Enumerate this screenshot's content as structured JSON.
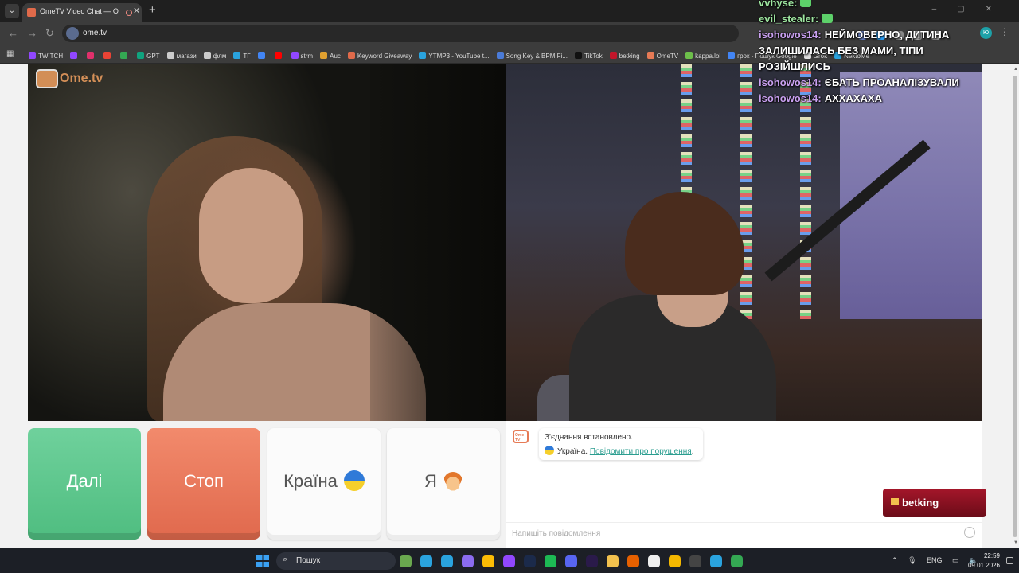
{
  "browser": {
    "tab_title": "OmeTV Video Chat — Ome",
    "url": "ome.tv",
    "bookmarks": [
      {
        "label": "TWITCH",
        "color": "#9147ff"
      },
      {
        "label": "",
        "color": "#9147ff"
      },
      {
        "label": "",
        "color": "#e1306c"
      },
      {
        "label": "",
        "color": "#ea4335"
      },
      {
        "label": "",
        "color": "#34a853"
      },
      {
        "label": "GPT",
        "color": "#10a37f"
      },
      {
        "label": "магази",
        "color": "#cccccc"
      },
      {
        "label": "флм",
        "color": "#cccccc"
      },
      {
        "label": "ТГ",
        "color": "#2aa3de"
      },
      {
        "label": "",
        "color": "#4285f4"
      },
      {
        "label": "",
        "color": "#ff0000"
      },
      {
        "label": "strm",
        "color": "#9147ff"
      },
      {
        "label": "Auc",
        "color": "#e0a030"
      },
      {
        "label": "Keyword Giveaway",
        "color": "#e06a4a"
      },
      {
        "label": "YTMP3 - YouTube t...",
        "color": "#2aa3de"
      },
      {
        "label": "Song Key & BPM Fi...",
        "color": "#4a7bd8"
      },
      {
        "label": "TikTok",
        "color": "#111111"
      },
      {
        "label": "betking",
        "color": "#c0162a"
      },
      {
        "label": "OmeTV",
        "color": "#e67a55"
      },
      {
        "label": "kappa.lol",
        "color": "#6dbf4a"
      },
      {
        "label": "грок - Пошук Google",
        "color": "#4285f4"
      },
      {
        "label": "Grok",
        "color": "#dddddd"
      },
      {
        "label": "NektoMe",
        "color": "#2aa3de"
      }
    ]
  },
  "page": {
    "watermark": "Ome.tv",
    "buttons": {
      "next": "Далі",
      "stop": "Стоп",
      "country": "Країна",
      "me": "Я"
    },
    "chat": {
      "avatar_text": "Ome TV",
      "status": "З'єднання встановлено.",
      "country": "Україна.",
      "report_link": "Повідомити про порушення",
      "report_suffix": ".",
      "input_placeholder": "Напишіть повідомлення"
    }
  },
  "overlay": {
    "messages": [
      {
        "user": "vvhyse:",
        "text": "",
        "user_color": "green",
        "emote": true
      },
      {
        "user": "evil_stealer:",
        "text": "",
        "user_color": "green",
        "emote": true
      },
      {
        "user": "isohowos14:",
        "text": "НЕЙМОВЕРНО, ДИТИНА ЗАЛИШИЛАСЬ БЕЗ МАМИ, ТІПИ РОЗІЙШЛИСЬ",
        "user_color": "purple",
        "emote": false
      },
      {
        "user": "isohowos14:",
        "text": "ЄБАТЬ ПРОАНАЛІЗУВАЛИ",
        "user_color": "purple",
        "emote": false
      },
      {
        "user": "isohowos14:",
        "text": "АХХАХАХА",
        "user_color": "purple",
        "emote": false
      }
    ],
    "betking_label": "betking"
  },
  "taskbar": {
    "search_label": "Пошук",
    "apps": [
      {
        "name": "widgets",
        "color": "#6aa84f"
      },
      {
        "name": "edge",
        "color": "#2aa3de"
      },
      {
        "name": "telegram",
        "color": "#2aa3de"
      },
      {
        "name": "copilot",
        "color": "#8b6cf0"
      },
      {
        "name": "chrome",
        "color": "#fbbc05"
      },
      {
        "name": "twitch",
        "color": "#9147ff"
      },
      {
        "name": "photoshop",
        "color": "#1b2a4a"
      },
      {
        "name": "spotify",
        "color": "#1db954"
      },
      {
        "name": "discord",
        "color": "#5865f2"
      },
      {
        "name": "premiere",
        "color": "#2a1a4a"
      },
      {
        "name": "explorer",
        "color": "#f2c14e"
      },
      {
        "name": "firefox",
        "color": "#e66000"
      },
      {
        "name": "file",
        "color": "#eeeeee"
      },
      {
        "name": "app",
        "color": "#f5b800"
      },
      {
        "name": "obs",
        "color": "#444444"
      },
      {
        "name": "telegram-2",
        "color": "#2aa3de"
      },
      {
        "name": "chrome-2",
        "color": "#34a853"
      }
    ],
    "lang": "ENG",
    "time": "22:59",
    "date": "09.01.2026"
  }
}
